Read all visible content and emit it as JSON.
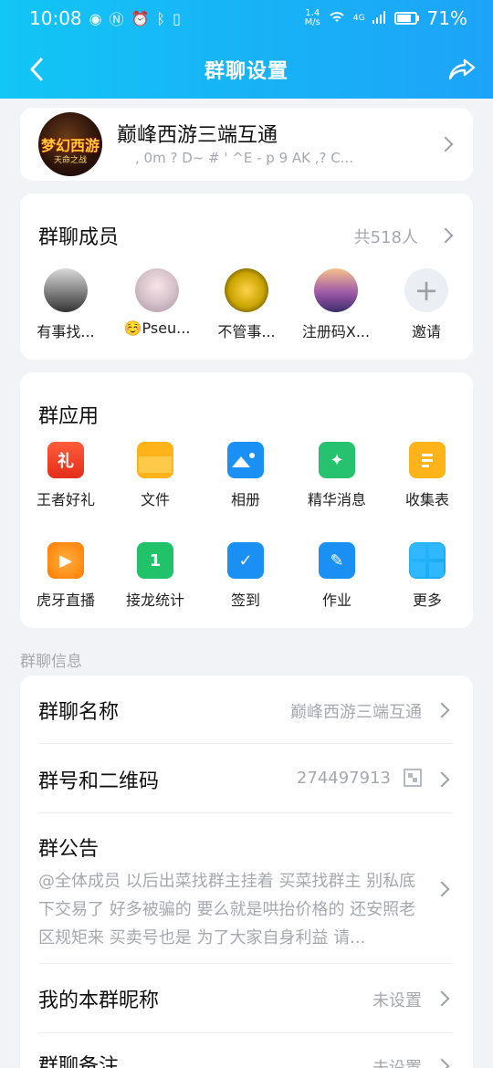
{
  "status": {
    "time": "10:08",
    "speed_value": "1.4",
    "speed_unit": "M/s",
    "network": "4G",
    "battery": "71%"
  },
  "nav": {
    "title": "群聊设置"
  },
  "group": {
    "name": "巅峰西游三端互通",
    "subtitle": ",          0m ? D~ # ' ^E     -    p 9 AK ,? C...",
    "avatar_text": "梦幻西游",
    "avatar_sub": "天命之战"
  },
  "members": {
    "title": "群聊成员",
    "count": "共518人",
    "list": [
      {
        "name": "有事找..."
      },
      {
        "name": "☺️Pseu..."
      },
      {
        "name": "不管事..."
      },
      {
        "name": "注册码X..."
      },
      {
        "name": "邀请"
      }
    ]
  },
  "apps": {
    "title": "群应用",
    "items": [
      {
        "label": "王者好礼",
        "icon": "gift-icon"
      },
      {
        "label": "文件",
        "icon": "folder-icon"
      },
      {
        "label": "相册",
        "icon": "album-icon"
      },
      {
        "label": "精华消息",
        "icon": "essence-icon"
      },
      {
        "label": "收集表",
        "icon": "form-icon"
      },
      {
        "label": "虎牙直播",
        "icon": "huya-icon"
      },
      {
        "label": "接龙统计",
        "icon": "chain-icon"
      },
      {
        "label": "签到",
        "icon": "checkin-icon"
      },
      {
        "label": "作业",
        "icon": "homework-icon"
      },
      {
        "label": "更多",
        "icon": "more-icon"
      }
    ]
  },
  "info": {
    "section_label": "群聊信息",
    "rows": [
      {
        "label": "群聊名称",
        "value": "巅峰西游三端互通"
      },
      {
        "label": "群号和二维码",
        "value": "274497913"
      },
      {
        "label": "群公告",
        "value": "@全体成员 以后出菜找群主挂着 买菜找群主 别私底下交易了 好多被骗的 要么就是哄抬价格的 还安照老区规矩来 买卖号也是 为了大家自身利益 请..."
      },
      {
        "label": "我的本群昵称",
        "value": "未设置"
      },
      {
        "label": "群聊备注",
        "value": "未设置"
      }
    ]
  }
}
